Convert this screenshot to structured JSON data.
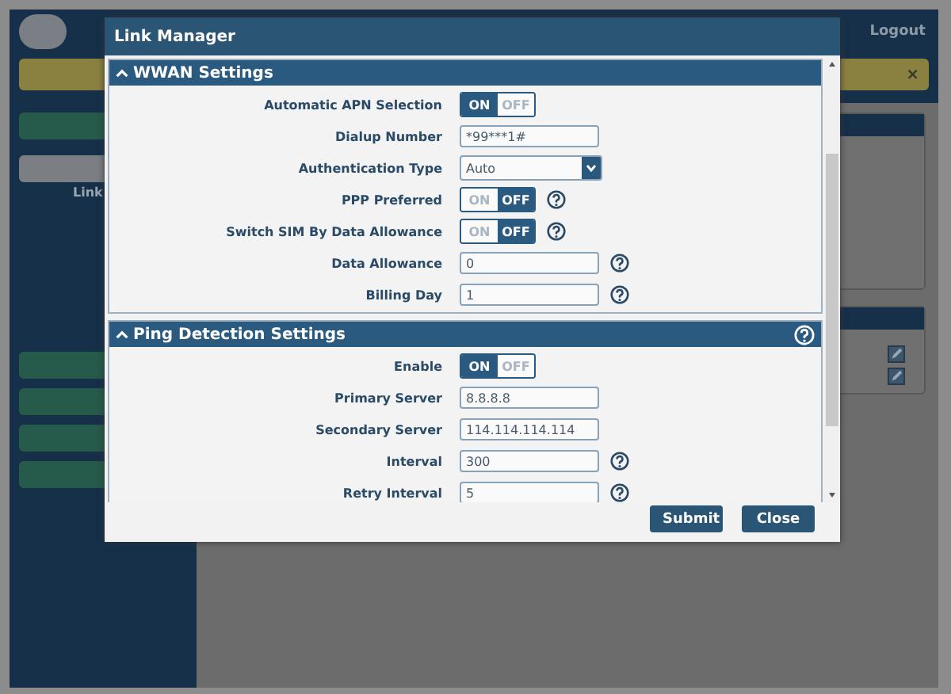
{
  "background": {
    "header_links": [
      "Logout"
    ],
    "notice_close": "×",
    "sidebar_label": "Link"
  },
  "dialog": {
    "title": "Link Manager",
    "sections": [
      {
        "title": "WWAN Settings",
        "expanded": true,
        "help": false,
        "fields": [
          {
            "label": "Automatic APN Selection",
            "kind": "toggle",
            "on": true,
            "on_label": "ON",
            "off_label": "OFF",
            "help": false
          },
          {
            "label": "Dialup Number",
            "kind": "text",
            "value": "*99***1#",
            "help": false
          },
          {
            "label": "Authentication Type",
            "kind": "select",
            "value": "Auto",
            "help": false
          },
          {
            "label": "PPP Preferred",
            "kind": "toggle",
            "on": false,
            "on_label": "ON",
            "off_label": "OFF",
            "help": true
          },
          {
            "label": "Switch SIM By Data Allowance",
            "kind": "toggle",
            "on": false,
            "on_label": "ON",
            "off_label": "OFF",
            "help": true
          },
          {
            "label": "Data Allowance",
            "kind": "text",
            "value": "0",
            "help": true
          },
          {
            "label": "Billing Day",
            "kind": "text",
            "value": "1",
            "help": true
          }
        ]
      },
      {
        "title": "Ping Detection Settings",
        "expanded": true,
        "help": true,
        "fields": [
          {
            "label": "Enable",
            "kind": "toggle",
            "on": true,
            "on_label": "ON",
            "off_label": "OFF",
            "help": false
          },
          {
            "label": "Primary Server",
            "kind": "text",
            "value": "8.8.8.8",
            "help": false
          },
          {
            "label": "Secondary Server",
            "kind": "text",
            "value": "114.114.114.114",
            "help": false
          },
          {
            "label": "Interval",
            "kind": "text",
            "value": "300",
            "help": true
          },
          {
            "label": "Retry Interval",
            "kind": "text",
            "value": "5",
            "help": true
          }
        ]
      }
    ],
    "buttons": [
      "Submit",
      "Close"
    ]
  }
}
